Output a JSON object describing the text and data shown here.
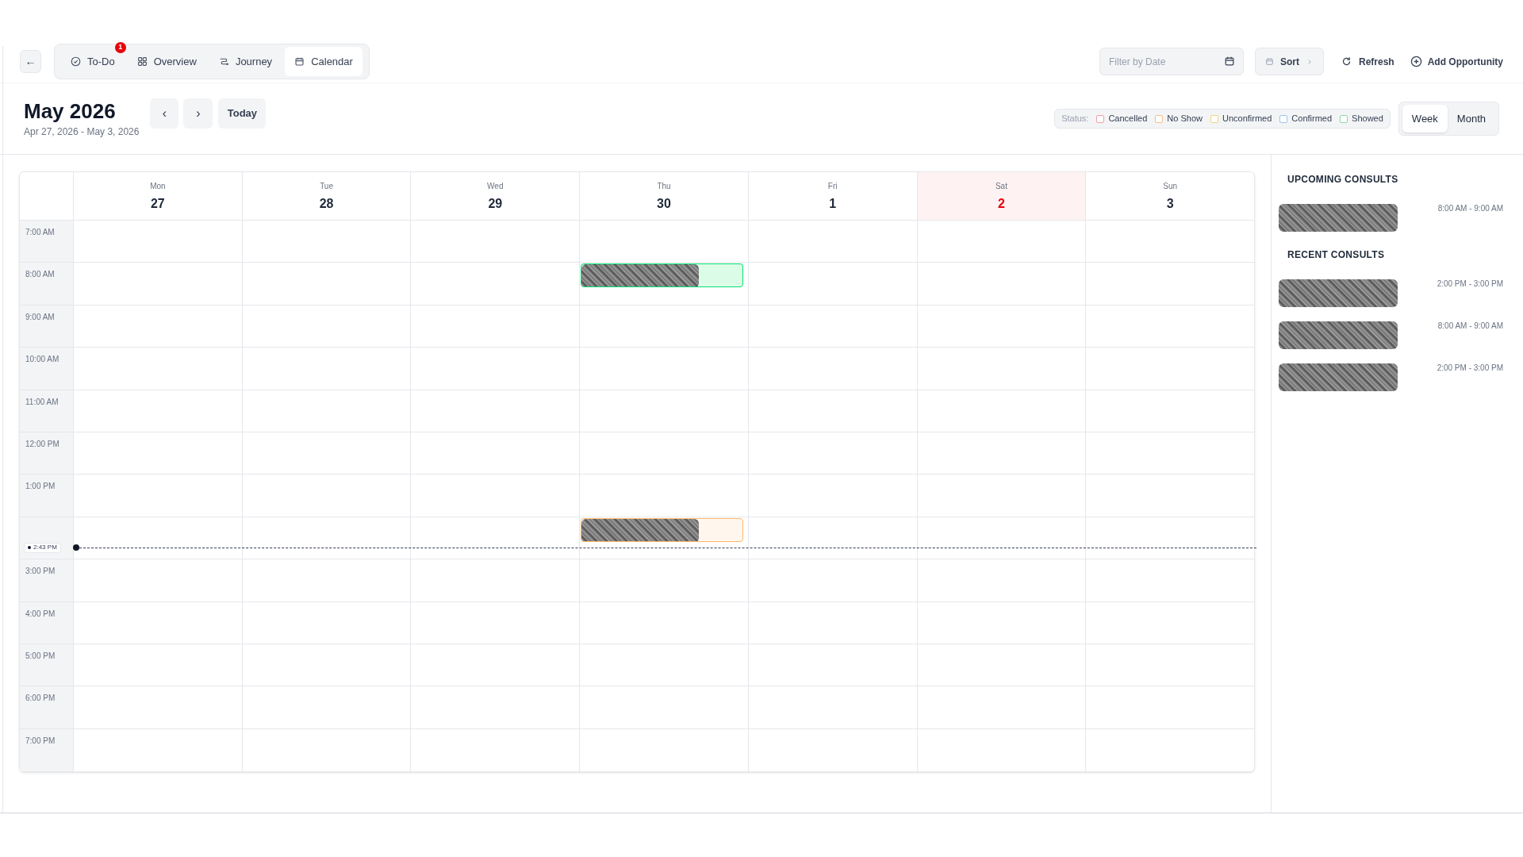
{
  "toolbar": {
    "back": "←",
    "tabs": [
      {
        "label": "To-Do",
        "badge": "1",
        "selected": false
      },
      {
        "label": "Overview",
        "selected": false
      },
      {
        "label": "Journey",
        "selected": false
      },
      {
        "label": "Calendar",
        "selected": true
      }
    ],
    "filter": {
      "placeholder": "Filter by Date"
    },
    "sort": "Sort",
    "refresh": "Refresh",
    "add": "Add Opportunity"
  },
  "header": {
    "title": "May 2026",
    "range": "Apr 27, 2026 - May 3, 2026",
    "prev": "‹",
    "next": "›",
    "today": "Today",
    "status_label": "Status:",
    "statuses": [
      {
        "label": "Cancelled",
        "color": "#f0a0a8"
      },
      {
        "label": "No Show",
        "color": "#f5c08a"
      },
      {
        "label": "Unconfirmed",
        "color": "#f2d67a"
      },
      {
        "label": "Confirmed",
        "color": "#9cc4f2"
      },
      {
        "label": "Showed",
        "color": "#8fd9a6"
      }
    ],
    "views": [
      {
        "label": "Week",
        "selected": true
      },
      {
        "label": "Month",
        "selected": false
      }
    ]
  },
  "calendar": {
    "days": [
      {
        "dow": "Mon",
        "date": "27",
        "selected": false
      },
      {
        "dow": "Tue",
        "date": "28",
        "selected": false
      },
      {
        "dow": "Wed",
        "date": "29",
        "selected": false
      },
      {
        "dow": "Thu",
        "date": "30",
        "selected": false
      },
      {
        "dow": "Fri",
        "date": "1",
        "selected": false
      },
      {
        "dow": "Sat",
        "date": "2",
        "selected": true
      },
      {
        "dow": "Sun",
        "date": "3",
        "selected": false
      }
    ],
    "rows": [
      {
        "label": "7:00 AM",
        "cells": [
          {
            "kind": "empty"
          },
          {
            "kind": "empty"
          },
          {
            "kind": "empty"
          },
          {
            "kind": "empty"
          },
          {
            "kind": "empty"
          },
          {
            "kind": "empty"
          },
          {
            "kind": "empty"
          }
        ]
      },
      {
        "label": "8:00 AM",
        "cells": [
          {
            "kind": "empty"
          },
          {
            "kind": "empty"
          },
          {
            "kind": "empty"
          },
          {
            "kind": "showed"
          },
          {
            "kind": "empty"
          },
          {
            "kind": "empty"
          },
          {
            "kind": "empty"
          }
        ]
      },
      {
        "label": "9:00 AM",
        "cells": [
          {
            "kind": "empty"
          },
          {
            "kind": "empty"
          },
          {
            "kind": "empty"
          },
          {
            "kind": "empty"
          },
          {
            "kind": "empty"
          },
          {
            "kind": "empty"
          },
          {
            "kind": "empty"
          }
        ]
      },
      {
        "label": "10:00 AM",
        "cells": [
          {
            "kind": "empty"
          },
          {
            "kind": "empty"
          },
          {
            "kind": "empty"
          },
          {
            "kind": "empty"
          },
          {
            "kind": "empty"
          },
          {
            "kind": "empty"
          },
          {
            "kind": "empty"
          }
        ]
      },
      {
        "label": "11:00 AM",
        "cells": [
          {
            "kind": "empty"
          },
          {
            "kind": "empty"
          },
          {
            "kind": "empty"
          },
          {
            "kind": "empty"
          },
          {
            "kind": "empty"
          },
          {
            "kind": "empty"
          },
          {
            "kind": "empty"
          }
        ]
      },
      {
        "label": "12:00 PM",
        "cells": [
          {
            "kind": "empty"
          },
          {
            "kind": "empty"
          },
          {
            "kind": "empty"
          },
          {
            "kind": "empty"
          },
          {
            "kind": "empty"
          },
          {
            "kind": "empty"
          },
          {
            "kind": "empty"
          }
        ]
      },
      {
        "label": "1:00 PM",
        "cells": [
          {
            "kind": "empty"
          },
          {
            "kind": "empty"
          },
          {
            "kind": "empty"
          },
          {
            "kind": "empty"
          },
          {
            "kind": "empty"
          },
          {
            "kind": "empty"
          },
          {
            "kind": "empty"
          }
        ]
      },
      {
        "now_marker": "2:43 PM",
        "cells": [
          {
            "kind": "empty"
          },
          {
            "kind": "empty"
          },
          {
            "kind": "empty"
          },
          {
            "kind": "no_show"
          },
          {
            "kind": "empty"
          },
          {
            "kind": "empty"
          },
          {
            "kind": "empty"
          }
        ]
      },
      {
        "label": "3:00 PM",
        "cells": [
          {
            "kind": "empty"
          },
          {
            "kind": "empty"
          },
          {
            "kind": "empty"
          },
          {
            "kind": "empty"
          },
          {
            "kind": "empty"
          },
          {
            "kind": "empty"
          },
          {
            "kind": "empty"
          }
        ]
      },
      {
        "label": "4:00 PM",
        "cells": [
          {
            "kind": "empty"
          },
          {
            "kind": "empty"
          },
          {
            "kind": "empty"
          },
          {
            "kind": "empty"
          },
          {
            "kind": "empty"
          },
          {
            "kind": "empty"
          },
          {
            "kind": "empty"
          }
        ]
      },
      {
        "label": "5:00 PM",
        "cells": [
          {
            "kind": "empty"
          },
          {
            "kind": "empty"
          },
          {
            "kind": "empty"
          },
          {
            "kind": "empty"
          },
          {
            "kind": "empty"
          },
          {
            "kind": "empty"
          },
          {
            "kind": "empty"
          }
        ]
      },
      {
        "label": "6:00 PM",
        "cells": [
          {
            "kind": "empty"
          },
          {
            "kind": "empty"
          },
          {
            "kind": "empty"
          },
          {
            "kind": "empty"
          },
          {
            "kind": "empty"
          },
          {
            "kind": "empty"
          },
          {
            "kind": "empty"
          }
        ]
      },
      {
        "label": "7:00 PM",
        "cells": [
          {
            "kind": "empty"
          },
          {
            "kind": "empty"
          },
          {
            "kind": "empty"
          },
          {
            "kind": "empty"
          },
          {
            "kind": "empty"
          },
          {
            "kind": "empty"
          },
          {
            "kind": "empty"
          }
        ]
      }
    ]
  },
  "sidebar": {
    "upcoming_title": "UPCOMING CONSULTS",
    "upcoming": [
      {
        "time": "8:00 AM - 9:00 AM"
      }
    ],
    "recent_title": "RECENT CONSULTS",
    "recent": [
      {
        "time": "2:00 PM - 3:00 PM"
      },
      {
        "time": "8:00 AM - 9:00 AM"
      },
      {
        "time": "2:00 PM - 3:00 PM"
      }
    ]
  }
}
